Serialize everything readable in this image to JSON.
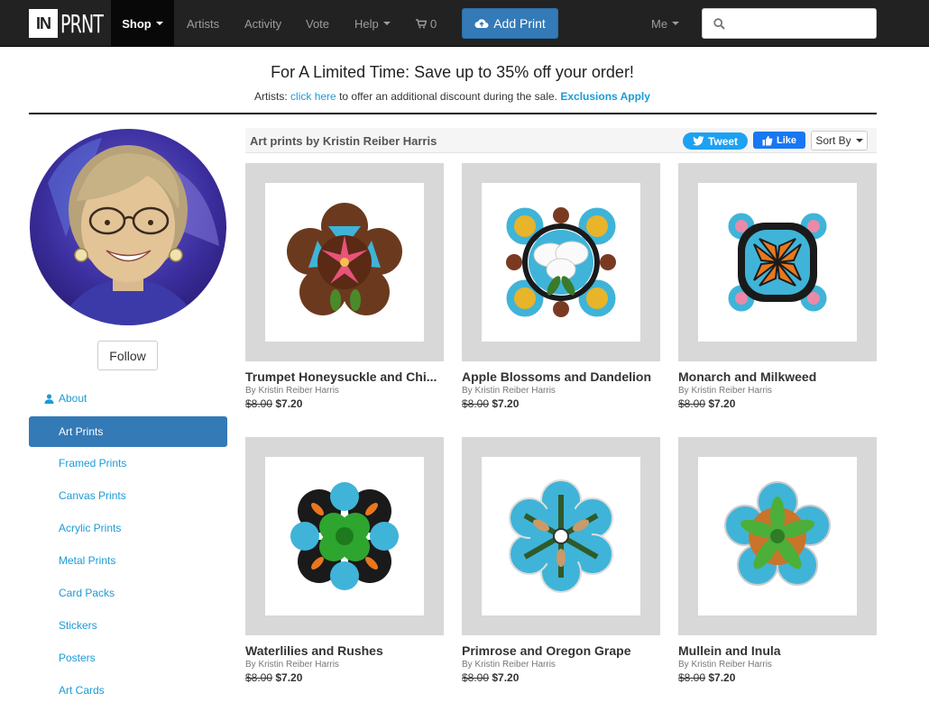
{
  "nav": {
    "logo_in": "IN",
    "logo_prnt": "PRNT",
    "shop": "Shop",
    "artists": "Artists",
    "activity": "Activity",
    "vote": "Vote",
    "help": "Help",
    "cart_count": "0",
    "add_print": "Add Print",
    "me": "Me",
    "search_placeholder": ""
  },
  "banner": {
    "title": "For A Limited Time: Save up to 35% off your order!",
    "prefix": "Artists: ",
    "link": "click here",
    "middle": " to offer an additional discount during the sale. ",
    "exclusions": "Exclusions Apply"
  },
  "sidebar": {
    "follow": "Follow",
    "items": [
      {
        "label": "About",
        "icon": "user-icon"
      },
      {
        "label": "Art Prints",
        "icon": "grid-icon"
      },
      {
        "label": "Framed Prints",
        "icon": "grid-icon"
      },
      {
        "label": "Canvas Prints",
        "icon": "grid-icon"
      },
      {
        "label": "Acrylic Prints",
        "icon": "grid-icon"
      },
      {
        "label": "Metal Prints",
        "icon": "grid-icon"
      },
      {
        "label": "Card Packs",
        "icon": "grid-icon"
      },
      {
        "label": "Stickers",
        "icon": "grid-icon"
      },
      {
        "label": "Posters",
        "icon": "grid-icon"
      },
      {
        "label": "Art Cards",
        "icon": "grid-icon"
      }
    ]
  },
  "content": {
    "title": "Art prints by Kristin Reiber Harris",
    "tweet": "Tweet",
    "like": "Like",
    "sort": "Sort By"
  },
  "products": [
    {
      "title": "Trumpet Honeysuckle and Chi...",
      "by": "By Kristin Reiber Harris",
      "old_price": "$8.00",
      "price": "$7.20"
    },
    {
      "title": "Apple Blossoms and Dandelion",
      "by": "By Kristin Reiber Harris",
      "old_price": "$8.00",
      "price": "$7.20"
    },
    {
      "title": "Monarch and Milkweed",
      "by": "By Kristin Reiber Harris",
      "old_price": "$8.00",
      "price": "$7.20"
    },
    {
      "title": "Waterlilies and Rushes",
      "by": "By Kristin Reiber Harris",
      "old_price": "$8.00",
      "price": "$7.20"
    },
    {
      "title": "Primrose and Oregon Grape",
      "by": "By Kristin Reiber Harris",
      "old_price": "$8.00",
      "price": "$7.20"
    },
    {
      "title": "Mullein and Inula",
      "by": "By Kristin Reiber Harris",
      "old_price": "$8.00",
      "price": "$7.20"
    }
  ],
  "colors": {
    "navbar": "#222222",
    "accent": "#337ab7",
    "link": "#1a9bd7"
  }
}
